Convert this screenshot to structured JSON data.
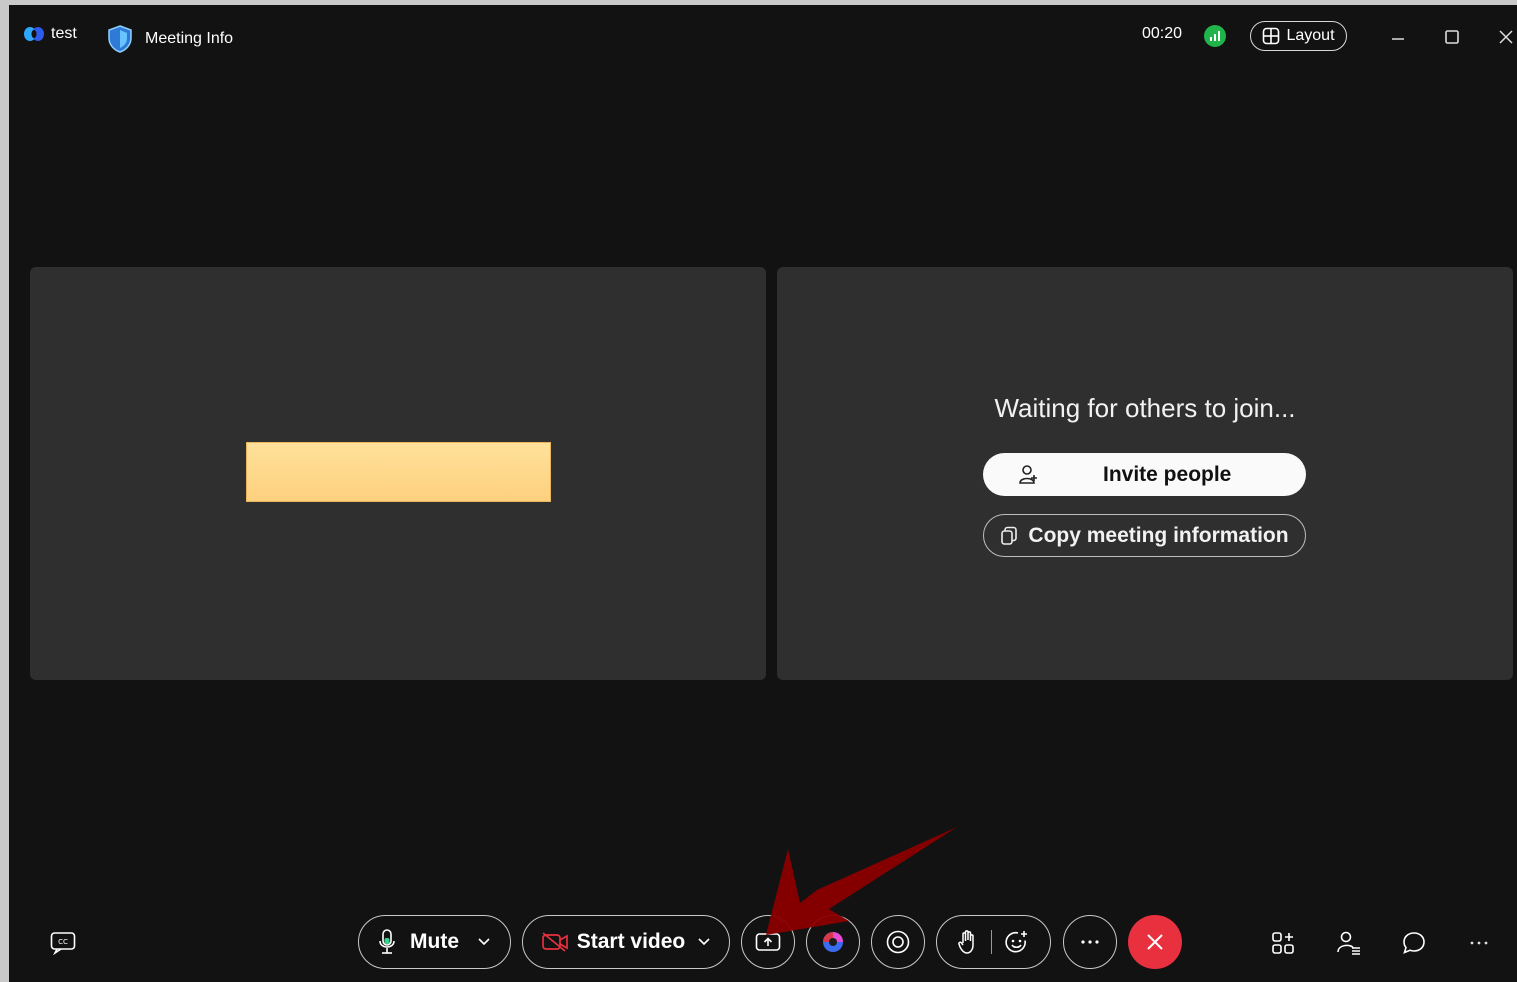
{
  "titlebar": {
    "app_name": "test",
    "meeting_info_label": "Meeting Info",
    "timer": "00:20",
    "layout_label": "Layout"
  },
  "stage": {
    "waiting_text": "Waiting for others to join...",
    "invite_label": "Invite people",
    "copy_label": "Copy meeting information"
  },
  "controls": {
    "mute_label": "Mute",
    "start_video_label": "Start video"
  },
  "colors": {
    "background": "#121212",
    "tile": "#2f2f2f",
    "leave": "#e8303f",
    "signal": "#1fb54a",
    "placeholder": "#fdd07e",
    "arrow": "#8b0000"
  }
}
